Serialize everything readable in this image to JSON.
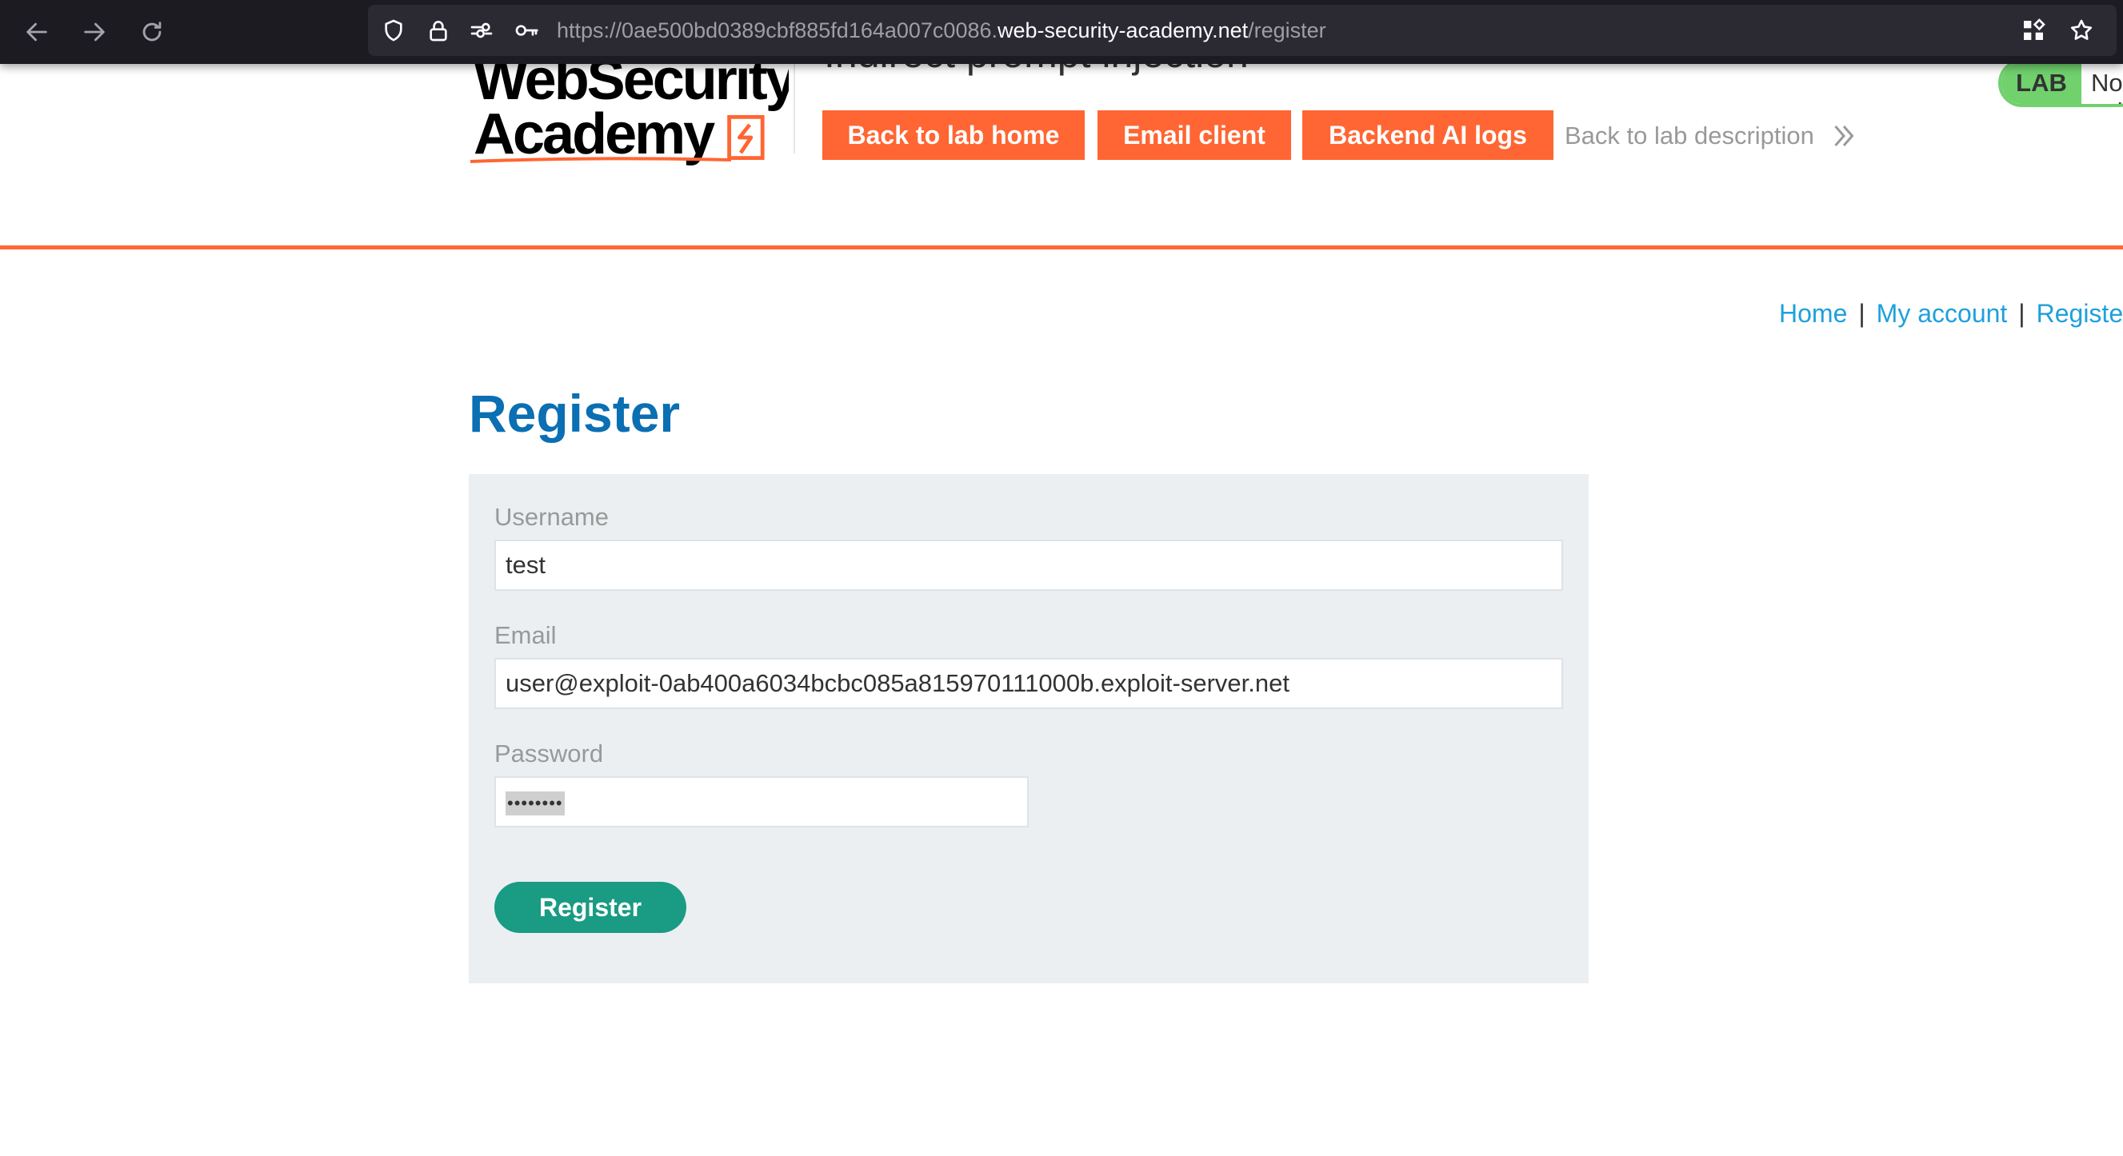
{
  "browser": {
    "url_scheme": "https://",
    "url_subdomain": "0ae500bd0389cbf885fd164a007c0086.",
    "url_domain": "web-security-academy.net",
    "url_path": "/register"
  },
  "lab_header": {
    "logo_line1": "WebSecurity",
    "logo_line2": "Academy",
    "title": "Indirect prompt injection",
    "buttons": [
      "Back to lab home",
      "Email client",
      "Backend AI logs"
    ],
    "description_link": "Back to lab description",
    "status_badge": "LAB",
    "status_text": "Not solved"
  },
  "top_links": {
    "home": "Home",
    "separator": "|",
    "my_account": "My account",
    "register": "Register"
  },
  "register_form": {
    "heading": "Register",
    "username_label": "Username",
    "username_value": "test",
    "email_label": "Email",
    "email_value": "user@exploit-0ab400a6034bcbc085a815970111000b.exploit-server.net",
    "password_label": "Password",
    "password_mask": "••••••••",
    "submit_label": "Register"
  },
  "colors": {
    "accent": "#ff6633",
    "link": "#1ea0dc",
    "heading": "#0a6fb3",
    "submit": "#1a9b83",
    "lab_status": "#70d16d"
  }
}
